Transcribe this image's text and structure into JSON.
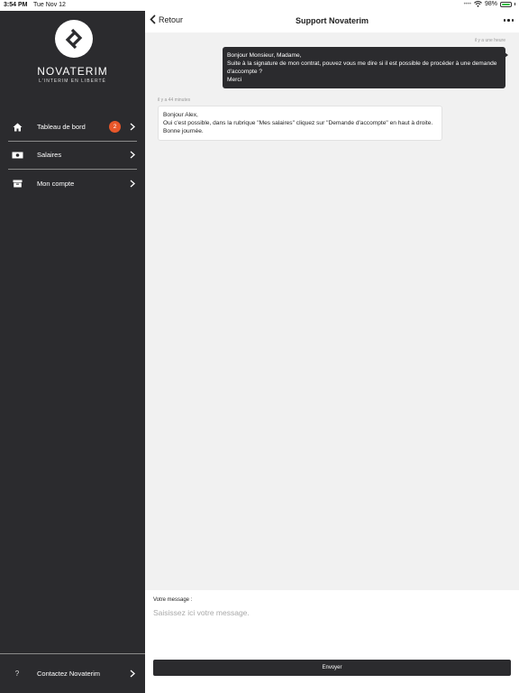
{
  "status_bar": {
    "time": "3:54 PM",
    "date": "Tue Nov 12",
    "battery": "98%",
    "battery_level": 0.98,
    "wifi_icon": "wifi-icon"
  },
  "sidebar": {
    "brand": "NOVATERIM",
    "tagline": "L'INTERIM EN LIBERTÉ",
    "logo_icon": "double-chevron-logo",
    "items": [
      {
        "label": "Tableau de bord",
        "icon": "home-icon",
        "badge": "2"
      },
      {
        "label": "Salaires",
        "icon": "banknote-icon"
      },
      {
        "label": "Mon compte",
        "icon": "archive-box-icon"
      }
    ],
    "footer": {
      "label": "Contactez Novaterim",
      "icon": "question-icon",
      "icon_glyph": "?"
    }
  },
  "header": {
    "back_label": "Retour",
    "title": "Support Novaterim",
    "more_icon": "more-dots-icon"
  },
  "messages": [
    {
      "direction": "sent",
      "time": "il y a une heure",
      "lines": [
        "Bonjour Monsieur, Madame,",
        "Suite à la signature de mon contrat, pouvez vous me dire si il est possible de procéder à une demande d'accompte ?",
        "Merci"
      ]
    },
    {
      "direction": "received",
      "time": "il y a 44 minutes",
      "lines": [
        "Bonjour Alex,",
        "Oui c'est possible, dans la rubrique \"Mes salaires\" cliquez sur \"Demande d'accompte\" en haut à droite.",
        "Bonne journée."
      ]
    }
  ],
  "composer": {
    "label": "Votre message :",
    "placeholder": "Saisissez ici votre message.",
    "value": "",
    "send_label": "Envoyer"
  },
  "colors": {
    "sidebar_bg": "#2b2b2e",
    "badge": "#e8572a",
    "chat_bg": "#f1f1f1",
    "battery_fill": "#3bc24a"
  }
}
